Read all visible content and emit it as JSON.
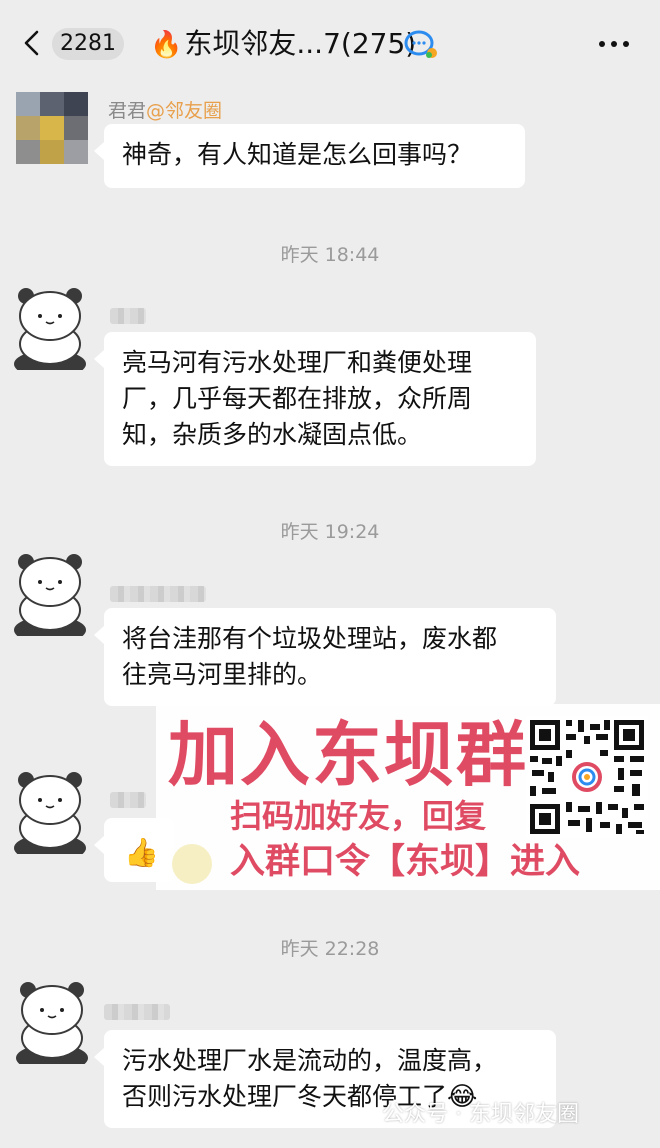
{
  "header": {
    "unread_count": "2281",
    "title": "东坝邻友...7(275)",
    "fire_icon": "🔥"
  },
  "messages": [
    {
      "sender": "君君",
      "sender_tag": "@邻友圈",
      "text": "神奇，有人知道是怎么回事吗？"
    },
    {
      "time": "昨天 18:44"
    },
    {
      "text_line1": "亮马河有污水处理厂和粪便处理",
      "text_line2": "厂，几乎每天都在排放，众所周",
      "text_line3": "知，杂质多的水凝固点低。"
    },
    {
      "time": "昨天 19:24"
    },
    {
      "text_line1": "将台洼那有个垃圾处理站，废水都",
      "text_line2": "往亮马河里排的。"
    },
    {
      "reaction": "👍"
    },
    {
      "time": "昨天 22:28"
    },
    {
      "text_line1": "污水处理厂水是流动的，温度高，",
      "text_line2": "否则污水处理厂冬天都停工了",
      "emoji": "😂"
    }
  ],
  "promo": {
    "headline": "加入东坝群",
    "line1": "扫码加好友，回复",
    "line2": "入群口令【东坝】进入"
  },
  "watermark": "公众号 · 东坝邻友圈",
  "colors": {
    "promo_text": "#e04b64",
    "background": "#ededed",
    "bubble": "#ffffff",
    "timestamp": "#9a9a9a"
  }
}
